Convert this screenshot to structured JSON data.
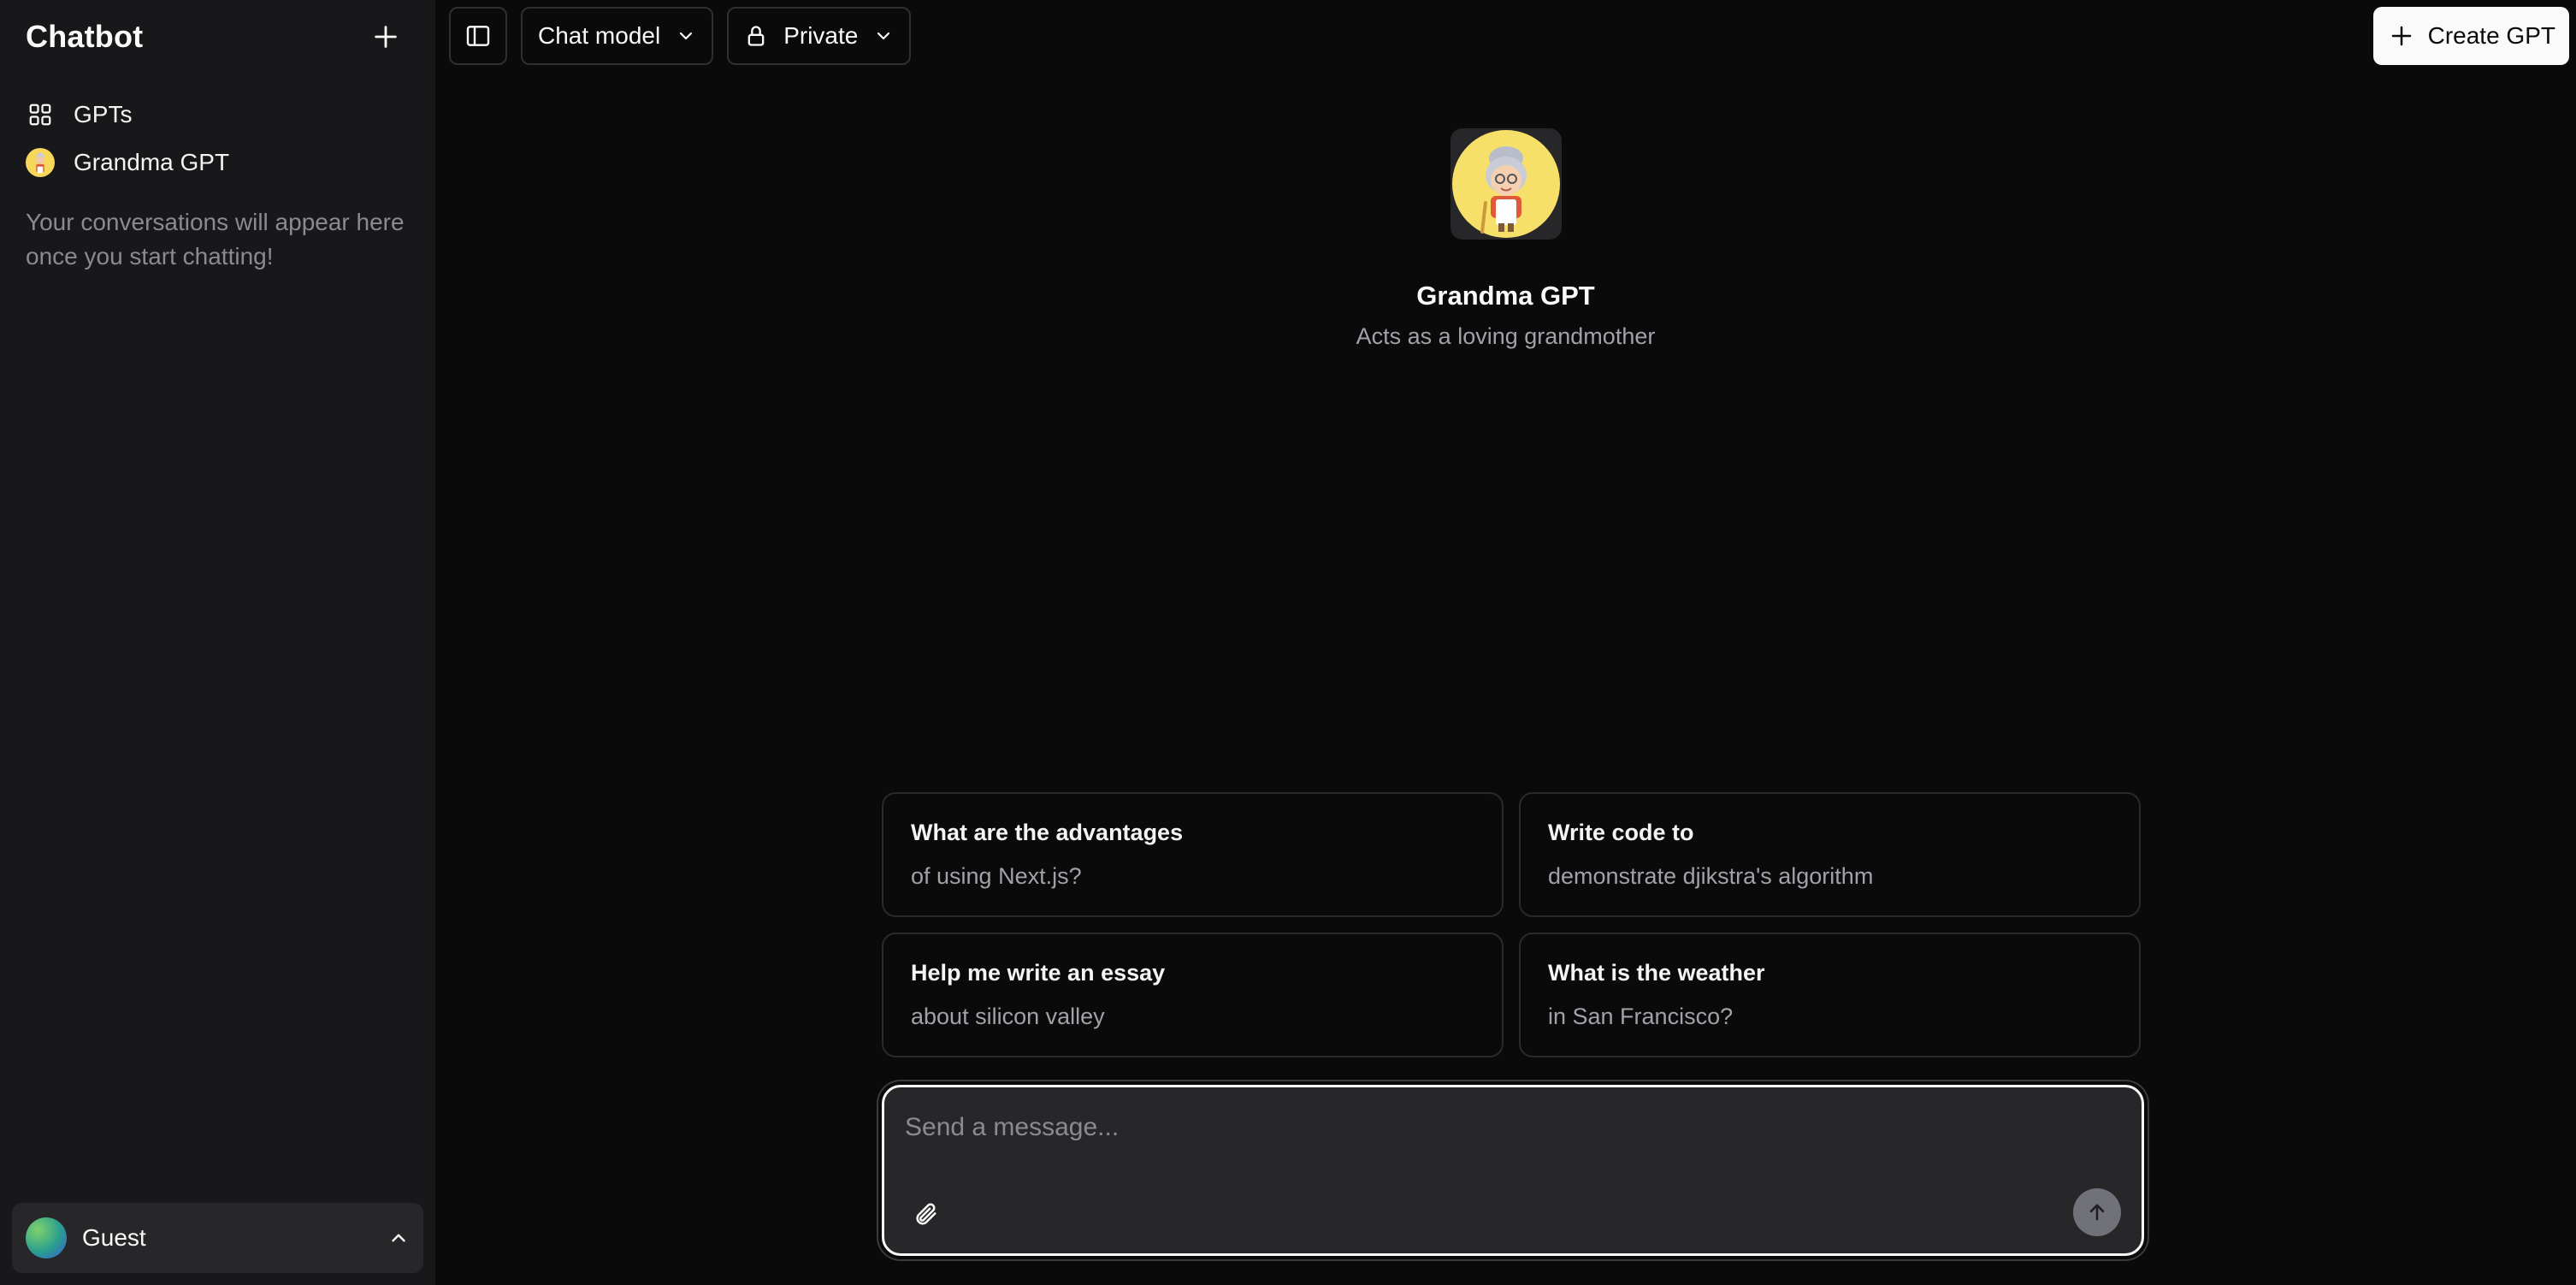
{
  "sidebar": {
    "title": "Chatbot",
    "nav": [
      {
        "label": "GPTs",
        "icon": "grid-icon"
      },
      {
        "label": "Grandma GPT",
        "icon": "grandma-avatar"
      }
    ],
    "empty_text": "Your conversations will appear here once you start chatting!",
    "user": {
      "name": "Guest"
    }
  },
  "topbar": {
    "model_label": "Chat model",
    "visibility_label": "Private",
    "create_label": "Create GPT"
  },
  "hero": {
    "title": "Grandma GPT",
    "subtitle": "Acts as a loving grandmother"
  },
  "suggestions": [
    {
      "title": "What are the advantages",
      "sub": "of using Next.js?"
    },
    {
      "title": "Write code to",
      "sub": "demonstrate djikstra's algorithm"
    },
    {
      "title": "Help me write an essay",
      "sub": "about silicon valley"
    },
    {
      "title": "What is the weather",
      "sub": "in San Francisco?"
    }
  ],
  "composer": {
    "placeholder": "Send a message...",
    "value": ""
  },
  "colors": {
    "background": "#0a0a0a",
    "sidebar": "#18181b",
    "accent_avatar": "#f7d85c"
  }
}
